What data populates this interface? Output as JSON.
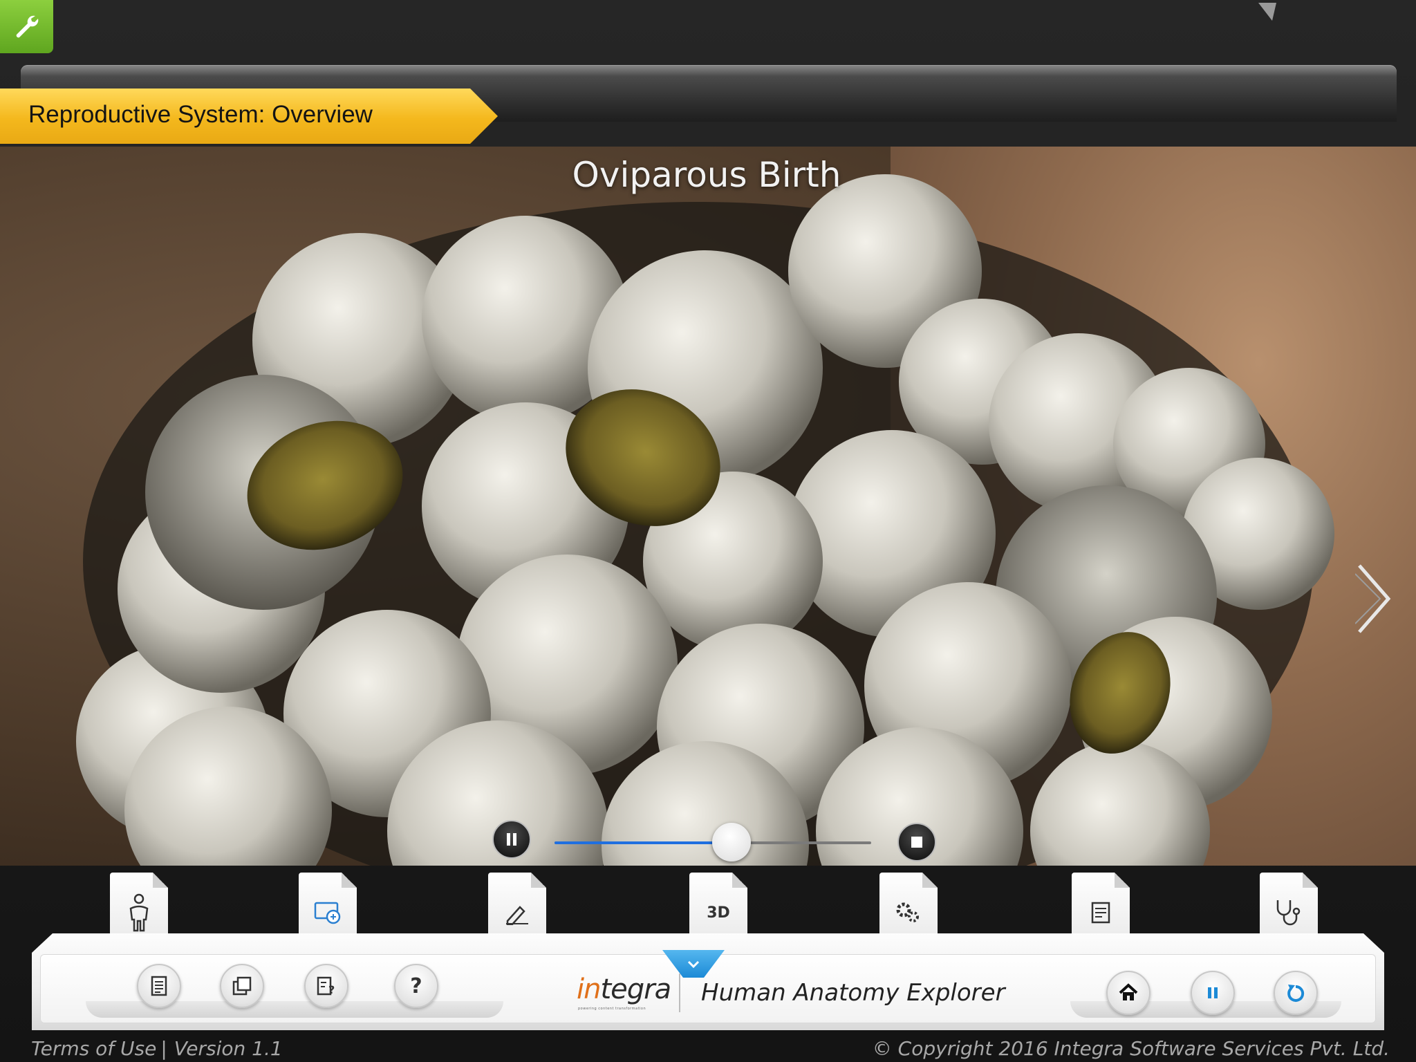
{
  "header": {
    "section_title": "Reproductive System: Overview"
  },
  "stage": {
    "caption": "Oviparous Birth",
    "playback_progress": 0.56
  },
  "tabs": [
    {
      "icon": "human-body-icon"
    },
    {
      "icon": "animation-icon"
    },
    {
      "icon": "draw-icon"
    },
    {
      "icon": "3d-icon",
      "label": "3D"
    },
    {
      "icon": "gears-icon"
    },
    {
      "icon": "notes-icon"
    },
    {
      "icon": "stethoscope-icon"
    }
  ],
  "dock": {
    "help_label": "?",
    "brand_part1": "in",
    "brand_part2": "tegra",
    "brand_tagline": "powering content transformation",
    "app_name": "Human Anatomy Explorer"
  },
  "footer": {
    "terms": "Terms of Use",
    "divider": "|",
    "version": "Version 1.1",
    "copyright": "© Copyright 2016 Integra Software Services Pvt. Ltd."
  },
  "colors": {
    "accent_green": "#6fb82b",
    "ribbon_yellow": "#f4b81d",
    "progress_blue": "#1f6fe0",
    "dock_tab_blue": "#1c8ad6",
    "brand_orange": "#e0701a"
  }
}
